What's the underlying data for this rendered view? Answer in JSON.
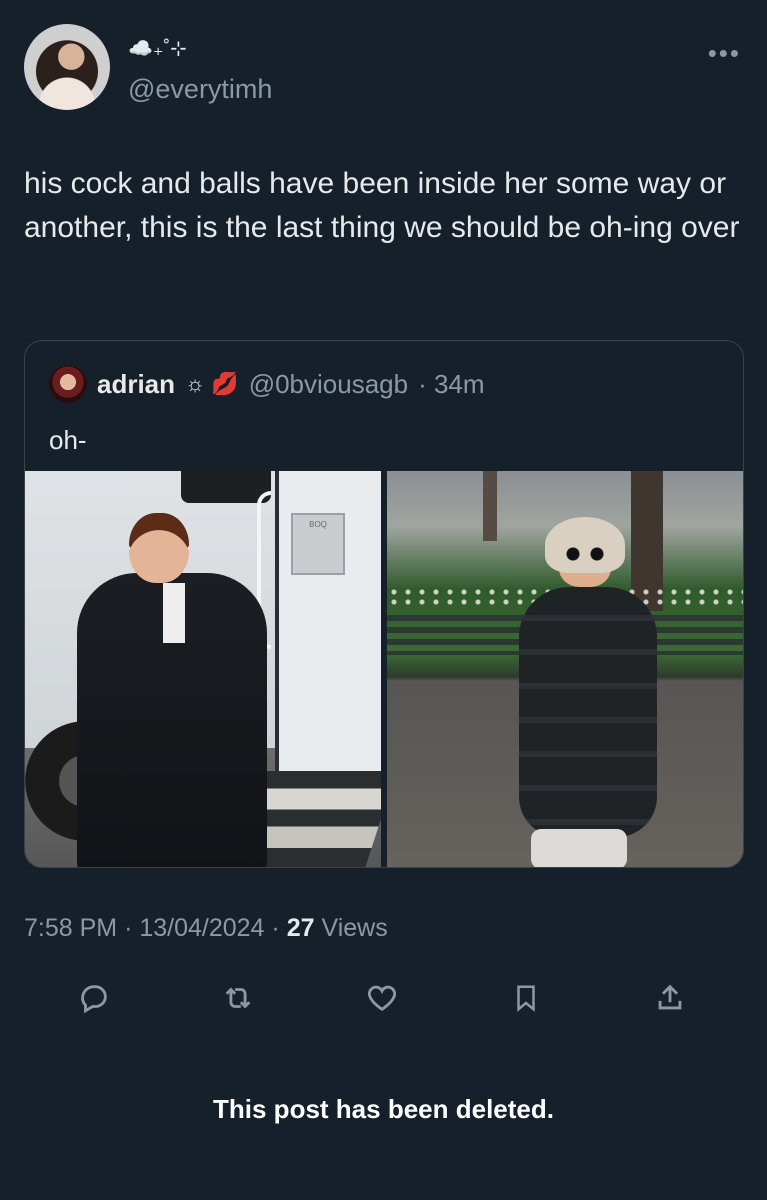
{
  "author": {
    "display_name": "☁️₊˚⊹",
    "handle": "@everytimh"
  },
  "tweet": {
    "text": "his cock and balls have been inside her some way or another, this is the last thing we should be oh-ing over"
  },
  "quoted": {
    "name": "adrian",
    "badges": "☼ 💋",
    "handle": "@0bviousagb",
    "time": "· 34m",
    "text": "oh-",
    "door_plate": "BOQ"
  },
  "meta": {
    "time": "7:58 PM",
    "date": "13/04/2024",
    "views_count": "27",
    "views_label": "Views"
  },
  "notice": "This post has been deleted.",
  "icons": [
    "reply-icon",
    "retweet-icon",
    "like-icon",
    "bookmark-icon",
    "share-icon",
    "more-icon"
  ],
  "colors": {
    "background": "#15202b",
    "text": "#e7e9ea",
    "muted": "#8b98a5",
    "border": "#38444d"
  }
}
